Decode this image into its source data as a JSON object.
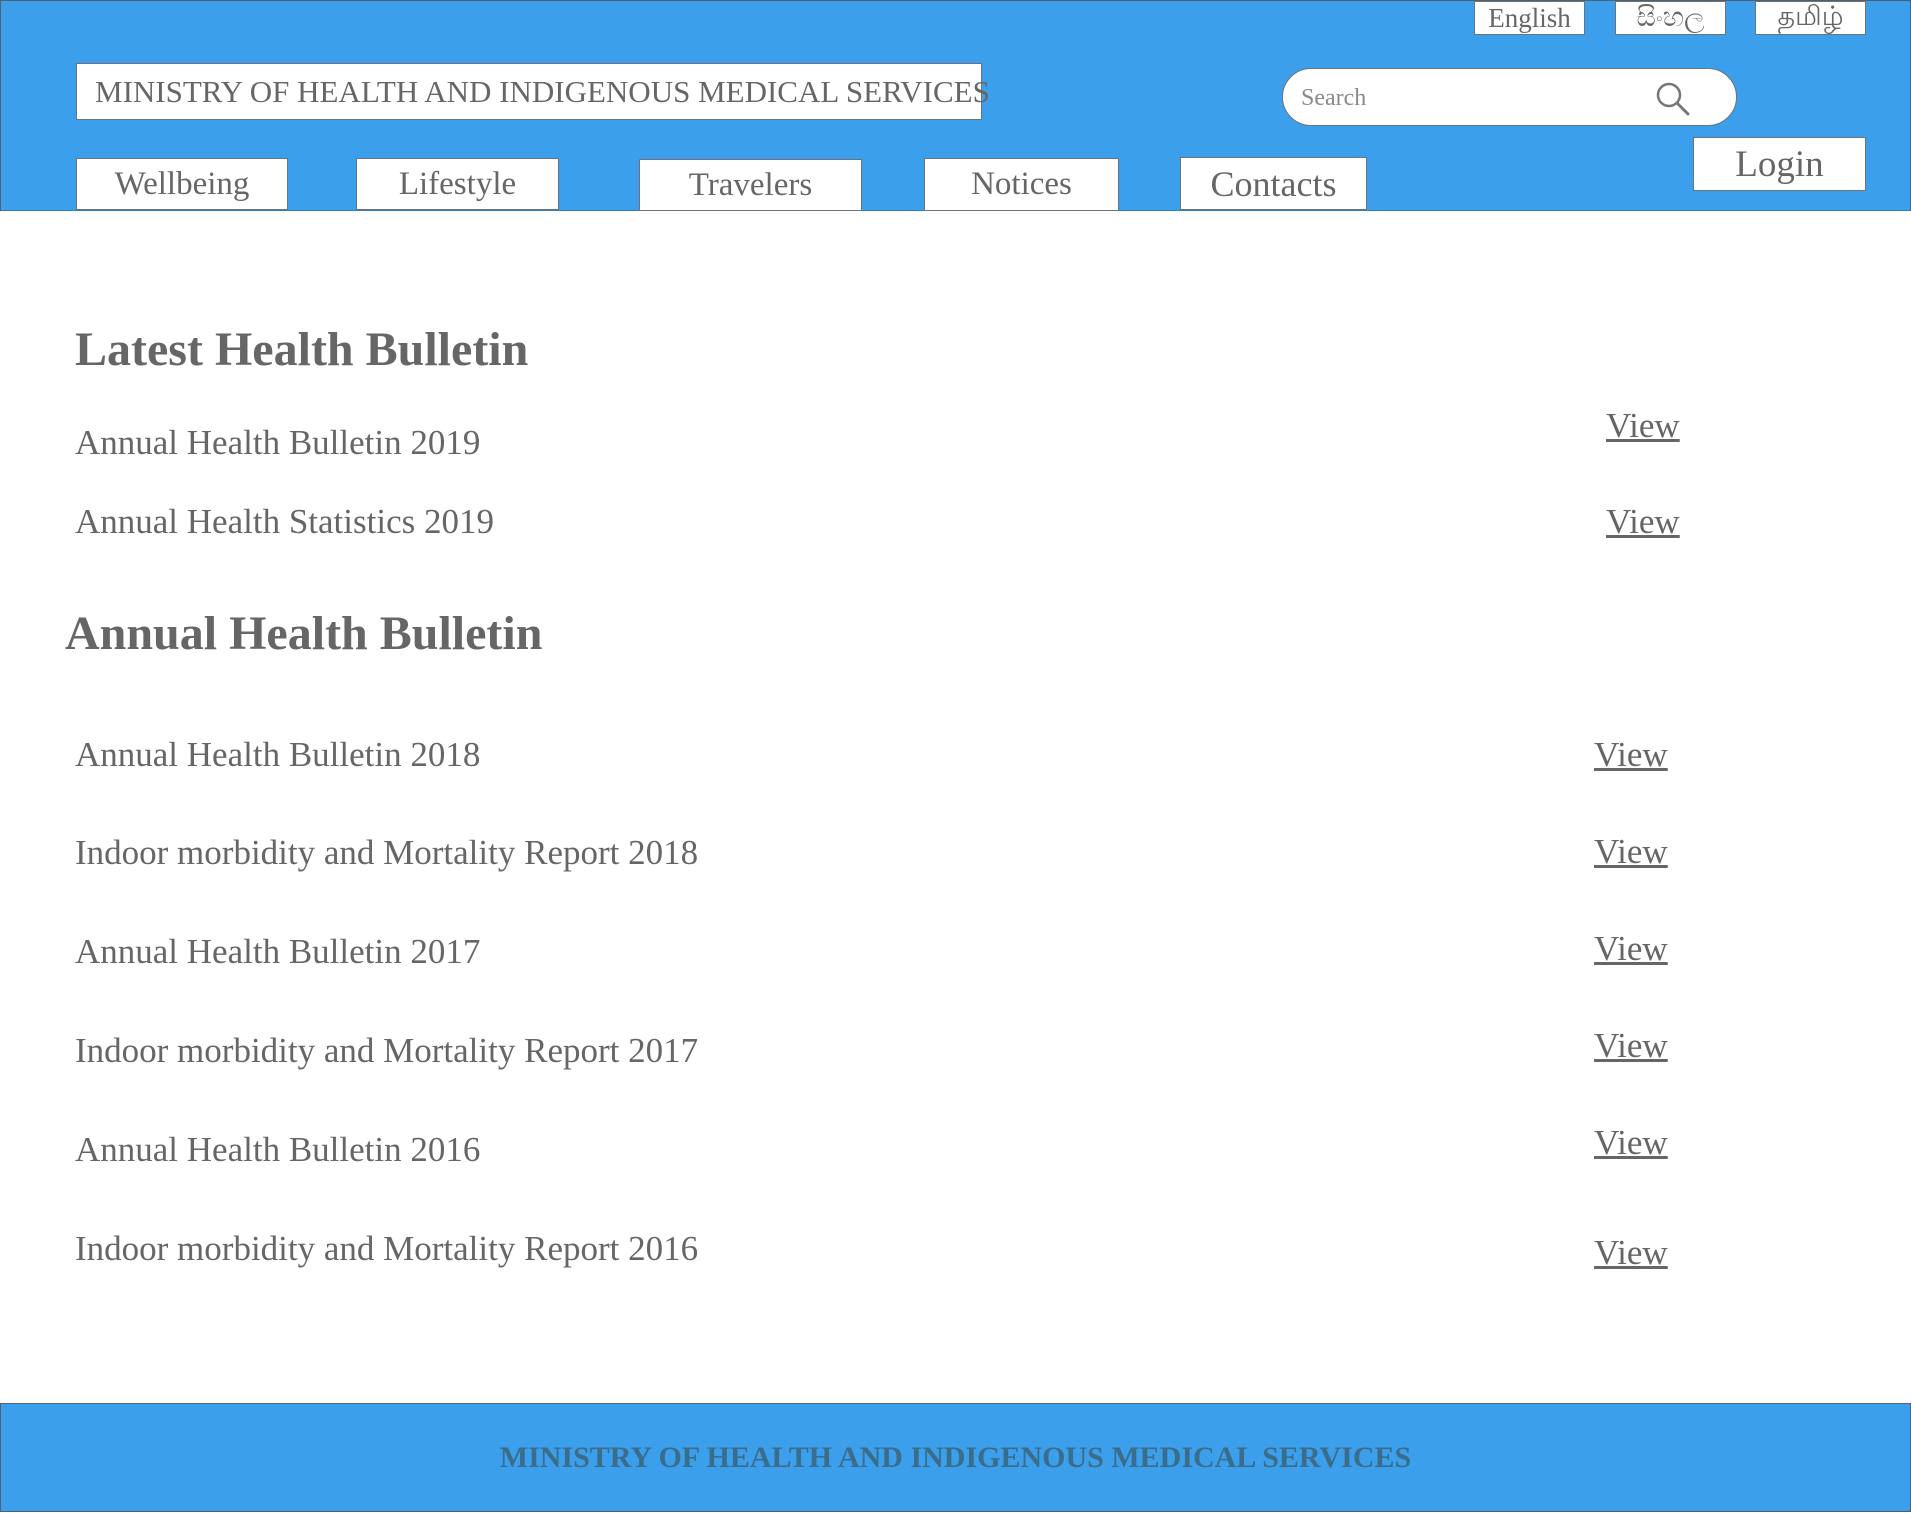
{
  "header": {
    "languages": [
      "English",
      "සිංහල",
      "தமிழ்"
    ],
    "site_title": "MINISTRY OF HEALTH AND INDIGENOUS MEDICAL SERVICES",
    "search": {
      "placeholder": "Search",
      "icon": "search-icon"
    },
    "nav": [
      "Wellbeing",
      "Lifestyle",
      "Travelers",
      "Notices",
      "Contacts"
    ],
    "login_label": "Login"
  },
  "latest": {
    "title": "Latest Health Bulletin",
    "items": [
      {
        "label": "Annual Health Bulletin 2019",
        "action": "View"
      },
      {
        "label": "Annual Health Statistics 2019",
        "action": "View"
      }
    ]
  },
  "annual": {
    "title": "Annual Health Bulletin",
    "items": [
      {
        "label": "Annual Health Bulletin 2018",
        "action": "View"
      },
      {
        "label": "Indoor morbidity and Mortality Report 2018",
        "action": "View"
      },
      {
        "label": "Annual Health Bulletin 2017",
        "action": "View"
      },
      {
        "label": "Indoor morbidity and Mortality Report 2017",
        "action": "View"
      },
      {
        "label": "Annual Health Bulletin 2016",
        "action": "View"
      },
      {
        "label": "Indoor morbidity and Mortality Report 2016",
        "action": "View"
      }
    ]
  },
  "footer": {
    "text": "MINISTRY OF HEALTH AND INDIGENOUS MEDICAL SERVICES"
  },
  "colors": {
    "header_bg": "#3c9fec",
    "text": "#666666",
    "footer_text": "#3b6d8a"
  }
}
